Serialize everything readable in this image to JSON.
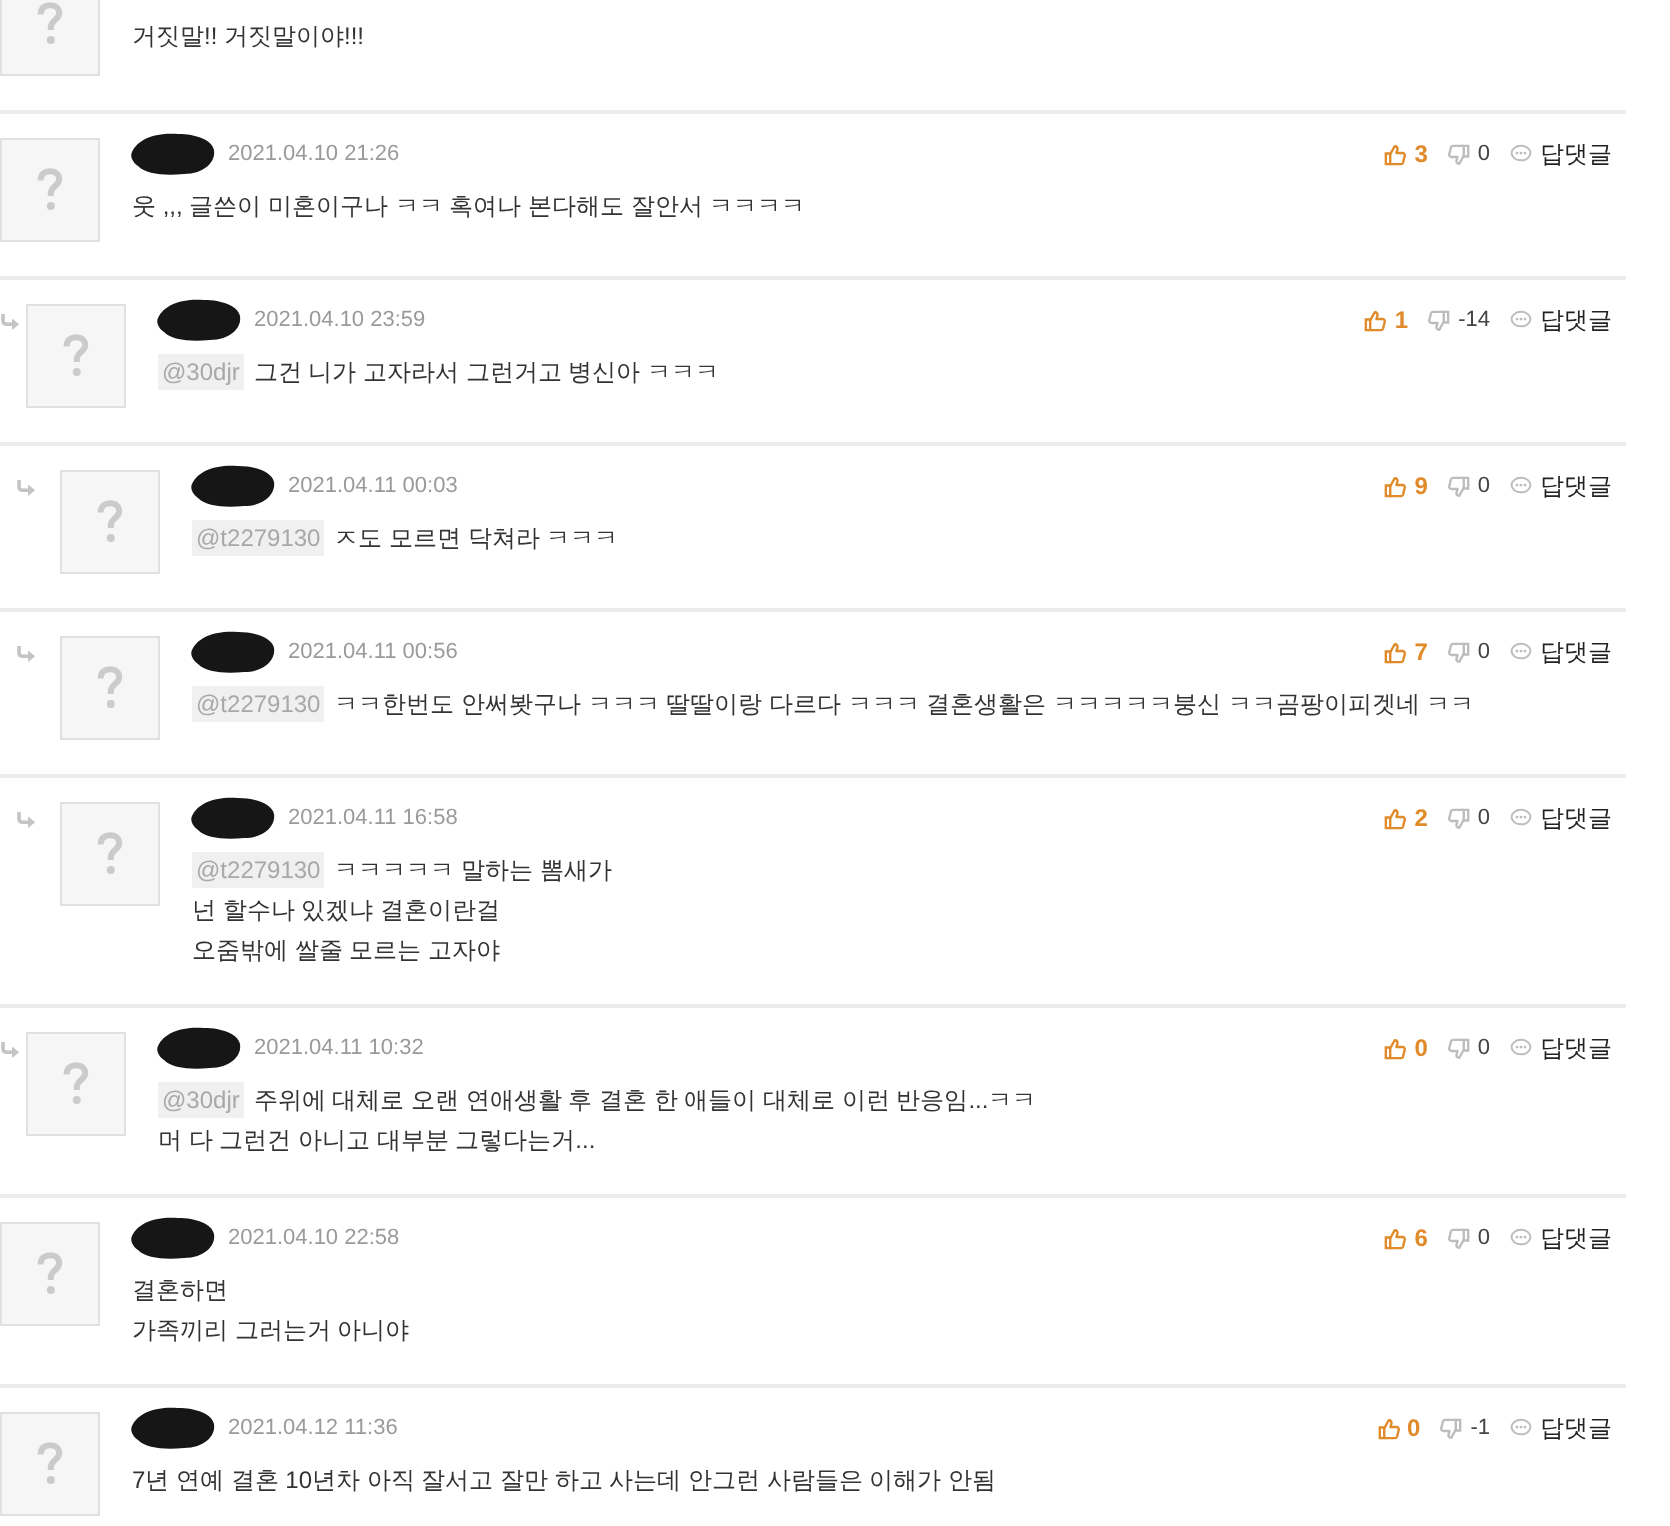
{
  "comments": [
    {
      "lines": [
        "거짓말!! 거짓말이야!!!"
      ]
    },
    {
      "name_redacted": true,
      "date": "2021.04.10 21:26",
      "likes": "3",
      "dislikes": "0",
      "reply_label": "답댓글",
      "lines": [
        "웃 ,,, 글쓴이 미혼이구나 ㅋㅋ 혹여나 본다해도 잘안서 ㅋㅋㅋㅋ"
      ],
      "children": [
        {
          "name_redacted": true,
          "date": "2021.04.10 23:59",
          "likes": "1",
          "dislikes": "-14",
          "reply_label": "답댓글",
          "mention": "@30djr",
          "lines": [
            "그건 니가 고자라서 그런거고 병신아 ㅋㅋㅋ"
          ],
          "children": [
            {
              "name_redacted": true,
              "date": "2021.04.11 00:03",
              "likes": "9",
              "dislikes": "0",
              "reply_label": "답댓글",
              "mention": "@t2279130",
              "lines": [
                "ㅈ도 모르면 닥쳐라 ㅋㅋㅋ"
              ]
            },
            {
              "name_redacted": true,
              "date": "2021.04.11 00:56",
              "likes": "7",
              "dislikes": "0",
              "reply_label": "답댓글",
              "mention": "@t2279130",
              "lines": [
                "ㅋㅋ한번도 안써봣구나 ㅋㅋㅋ 딸딸이랑 다르다 ㅋㅋㅋ 결혼생활은 ㅋㅋㅋㅋㅋ붕신 ㅋㅋ곰팡이피겟네 ㅋㅋ"
              ]
            },
            {
              "name_redacted": true,
              "date": "2021.04.11 16:58",
              "likes": "2",
              "dislikes": "0",
              "reply_label": "답댓글",
              "mention": "@t2279130",
              "lines": [
                "ㅋㅋㅋㅋㅋ 말하는 뽐새가",
                "넌 할수나 있겠냐 결혼이란걸",
                "오줌밖에 쌀줄 모르는 고자야"
              ]
            }
          ]
        },
        {
          "name_redacted": true,
          "date": "2021.04.11 10:32",
          "likes": "0",
          "dislikes": "0",
          "reply_label": "답댓글",
          "mention": "@30djr",
          "lines": [
            "주위에 대체로 오랜 연애생활 후 결혼 한 애들이 대체로 이런 반응임...ㅋㅋ",
            "머 다 그런건 아니고 대부분 그렇다는거..."
          ]
        }
      ]
    },
    {
      "name_redacted": true,
      "date": "2021.04.10 22:58",
      "likes": "6",
      "dislikes": "0",
      "reply_label": "답댓글",
      "lines": [
        "결혼하면",
        "가족끼리 그러는거 아니야"
      ]
    },
    {
      "name_redacted": true,
      "date": "2021.04.12 11:36",
      "likes": "0",
      "dislikes": "-1",
      "reply_label": "답댓글",
      "lines": [
        "7년 연예 결혼 10년차 아직 잘서고 잘만 하고 사는데 안그런 사람들은 이해가 안됨"
      ]
    }
  ]
}
